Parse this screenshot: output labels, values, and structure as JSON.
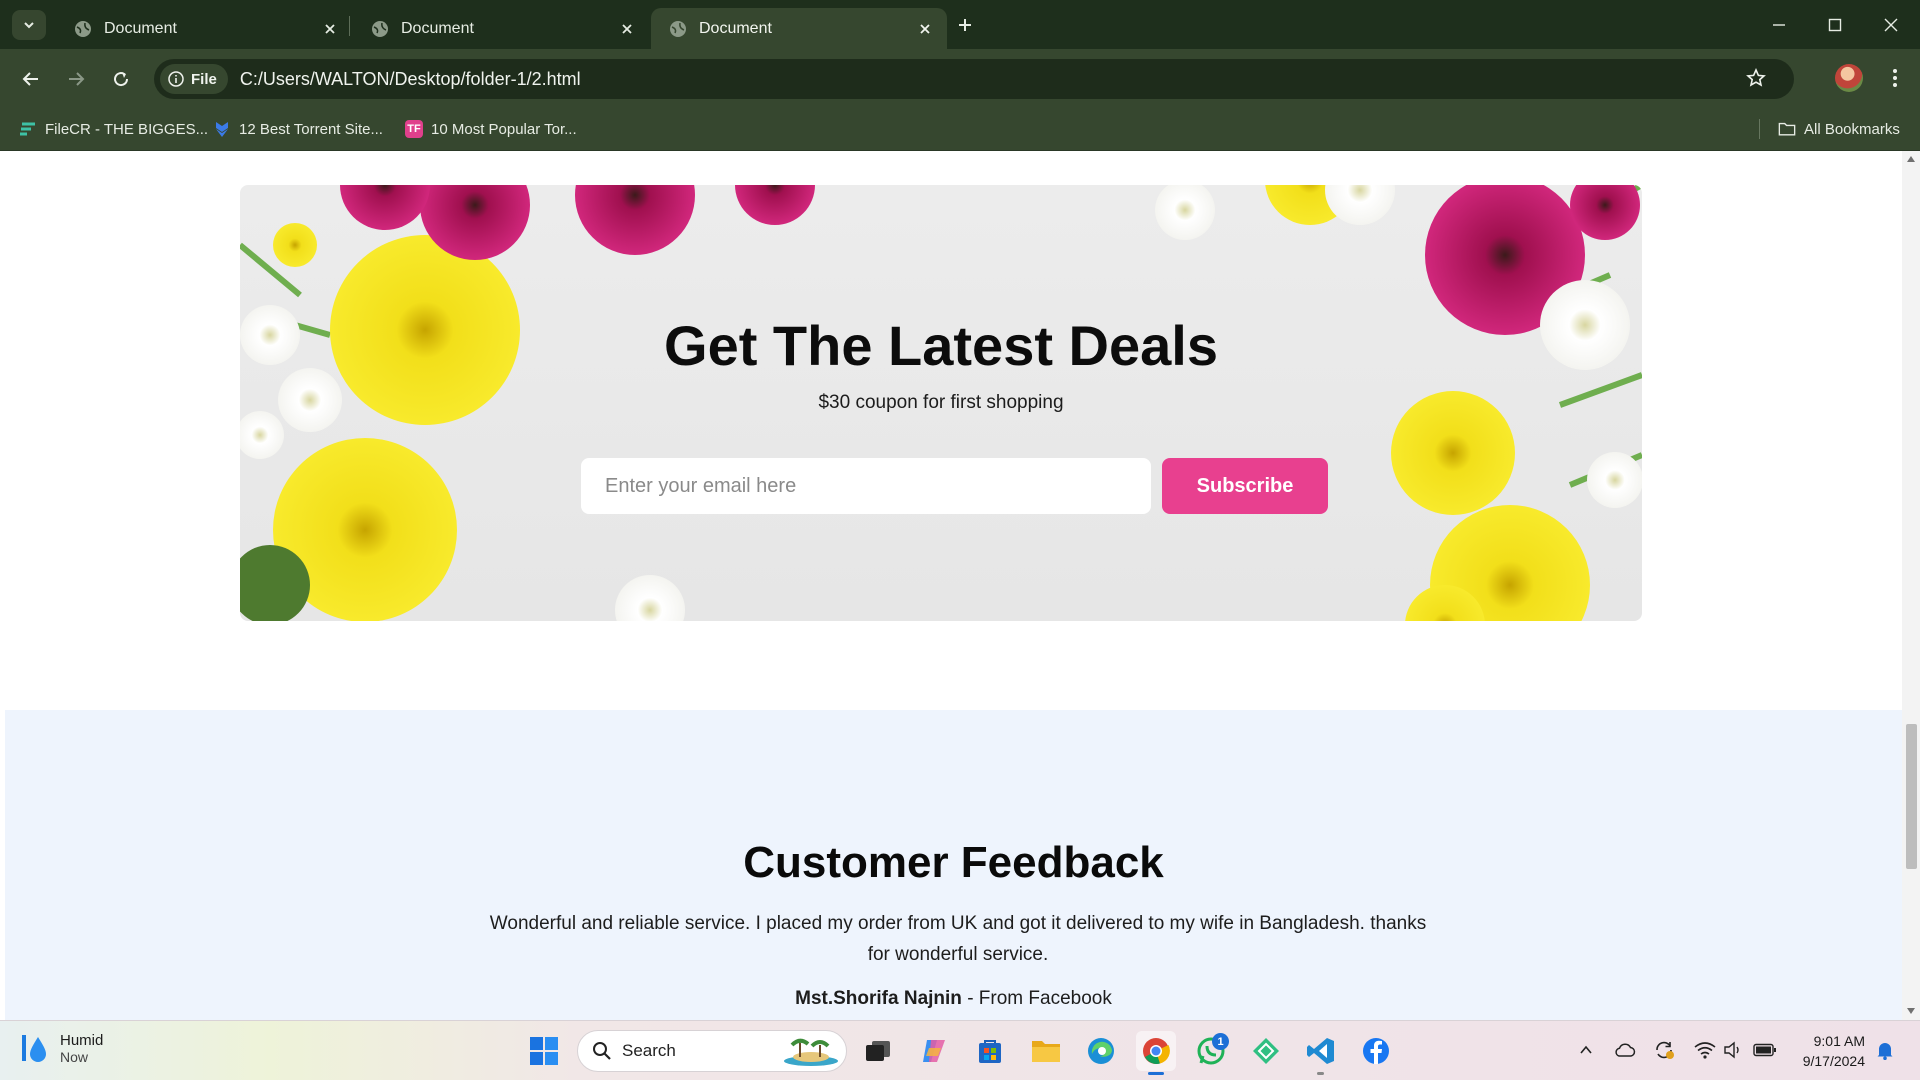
{
  "browser": {
    "tabs": [
      {
        "title": "Document",
        "active": false
      },
      {
        "title": "Document",
        "active": false
      },
      {
        "title": "Document",
        "active": true
      }
    ],
    "address": {
      "chip": "File",
      "url": "C:/Users/WALTON/Desktop/folder-1/2.html"
    },
    "bookmarks": [
      {
        "label": "FileCR - THE BIGGES...",
        "icon": "filecr-icon"
      },
      {
        "label": "12 Best Torrent Site...",
        "icon": "torrent-site-icon"
      },
      {
        "label": "10 Most Popular Tor...",
        "icon": "tf-icon"
      }
    ],
    "all_bookmarks": "All Bookmarks"
  },
  "page": {
    "deals": {
      "title": "Get The Latest Deals",
      "subtitle": "$30 coupon for first shopping",
      "email_placeholder": "Enter your email here",
      "button": "Subscribe"
    },
    "feedback": {
      "title": "Customer Feedback",
      "text": "Wonderful and reliable service. I placed my order from UK and got it delivered to my wife in Bangladesh. thanks for wonderful service.",
      "author": "Mst.Shorifa Najnin",
      "source": " - From Facebook"
    }
  },
  "taskbar": {
    "weather": {
      "title": "Humid",
      "sub": "Now"
    },
    "search": "Search",
    "whatsapp_badge": "1",
    "time": "9:01 AM",
    "date": "9/17/2024"
  },
  "colors": {
    "accent": "#e8408f",
    "chrome_dark": "#1e2f1c",
    "chrome": "#36472f",
    "feedback_bg": "#eef4fd"
  }
}
